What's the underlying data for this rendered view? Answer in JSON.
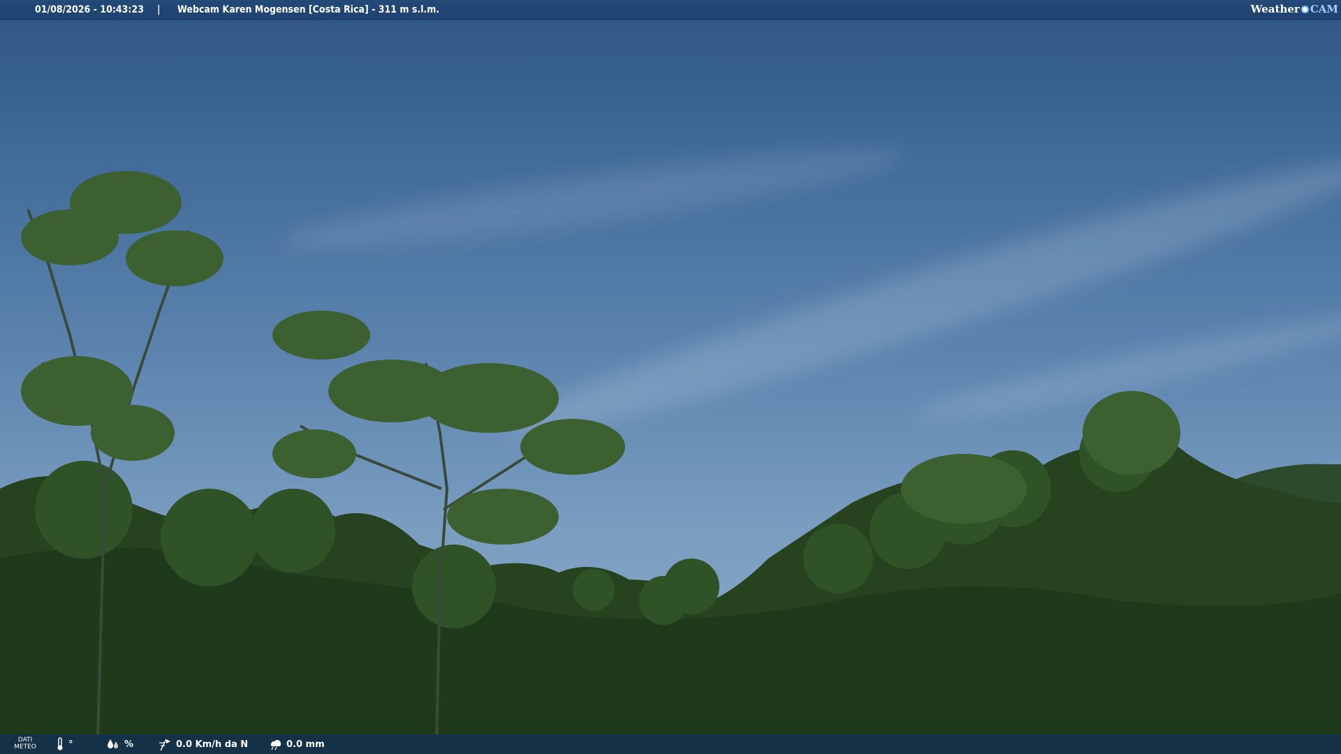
{
  "header": {
    "datetime": "01/08/2026 - 10:43:23",
    "separator": "|",
    "title": "Webcam Karen Mogensen [Costa Rica]  - 311 m s.l.m."
  },
  "brand": {
    "weather": "Weather",
    "cam": "CAM"
  },
  "footer": {
    "meteo_line1": "DATI",
    "meteo_line2": "METEO",
    "temperature": "°",
    "humidity": "%",
    "wind": "0.0 Km/h da N",
    "rain": "0.0 mm"
  },
  "icons": {
    "temperature": "thermometer-icon",
    "humidity": "humidity-drops-icon",
    "wind": "wind-vane-icon",
    "rain": "rain-cloud-icon"
  },
  "colors": {
    "topbar": "#244a78",
    "bottombar": "#123052",
    "sky_top": "#2f5585",
    "sky_bottom": "#8fb0cc",
    "foliage": "#2a4a22"
  }
}
